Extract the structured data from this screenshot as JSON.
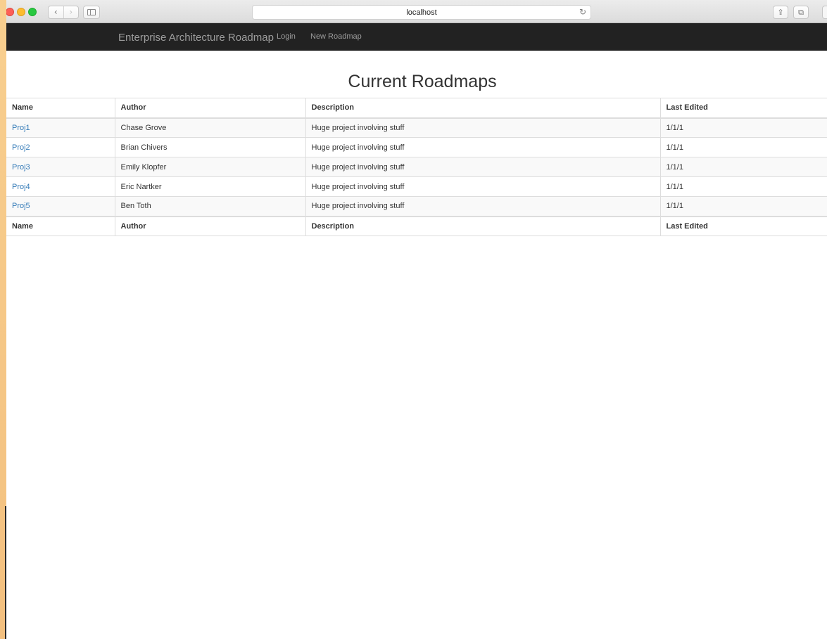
{
  "browser": {
    "url": "localhost",
    "nav_back": "‹",
    "nav_forward": "›",
    "reload_icon": "reload-icon",
    "share_icon": "share-icon",
    "tabs_icon": "tabs-icon"
  },
  "navbar": {
    "brand": "Enterprise Architecture Roadmap",
    "links": [
      "Login",
      "New Roadmap"
    ]
  },
  "main": {
    "title": "Current Roadmaps",
    "table": {
      "columns": [
        "Name",
        "Author",
        "Description",
        "Last Edited"
      ],
      "rows": [
        [
          "Proj1",
          "Chase Grove",
          "Huge project involving stuff",
          "1/1/1"
        ],
        [
          "Proj2",
          "Brian Chivers",
          "Huge project involving stuff",
          "1/1/1"
        ],
        [
          "Proj3",
          "Emily Klopfer",
          "Huge project involving stuff",
          "1/1/1"
        ],
        [
          "Proj4",
          "Eric Nartker",
          "Huge project involving stuff",
          "1/1/1"
        ],
        [
          "Proj5",
          "Ben Toth",
          "Huge project involving stuff",
          "1/1/1"
        ]
      ],
      "footer_columns": [
        "Name",
        "Author",
        "Description",
        "Last Edited"
      ]
    }
  },
  "colors": {
    "navbar_bg": "#222222",
    "link": "#337ab7",
    "desktop": "#f7c98a"
  }
}
